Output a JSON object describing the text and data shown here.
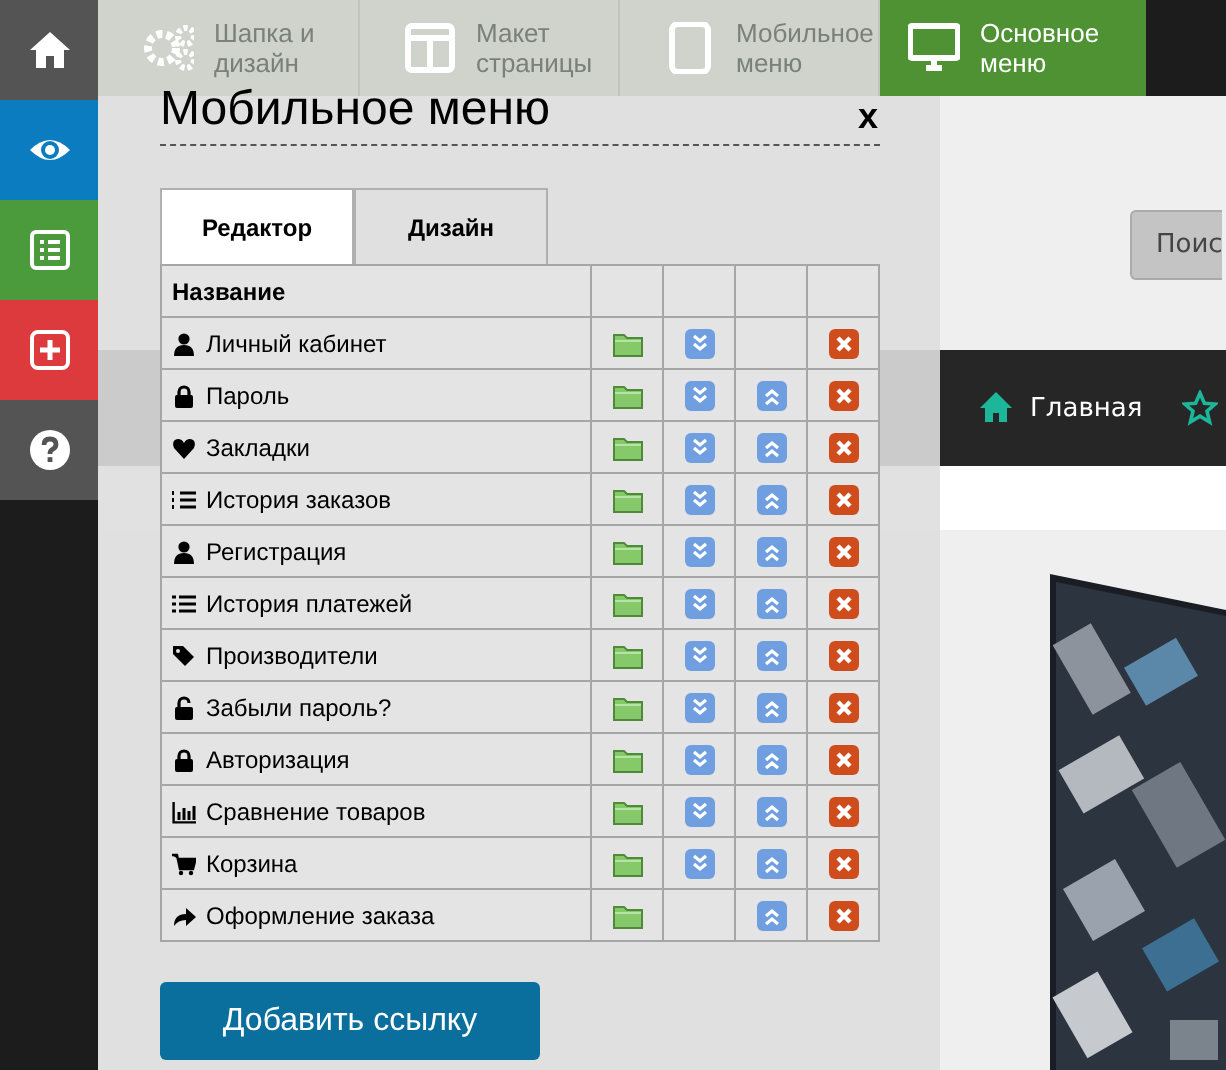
{
  "sidebar": {
    "items": [
      {
        "kind": "home",
        "color": "#545454"
      },
      {
        "kind": "eye",
        "color": "#0a7cbf"
      },
      {
        "kind": "list",
        "color": "#4b9a3c"
      },
      {
        "kind": "plus",
        "color": "#dc3a3d"
      },
      {
        "kind": "help",
        "color": "#545454"
      }
    ]
  },
  "top_tabs": [
    {
      "label": "Шапка и дизайн",
      "kind": "gears",
      "selected": false
    },
    {
      "label": "Макет страницы",
      "kind": "layout",
      "selected": false
    },
    {
      "label": "Мобильное меню",
      "kind": "tablet",
      "selected": false
    },
    {
      "label": "Основное меню",
      "kind": "monitor",
      "selected": true
    }
  ],
  "page": {
    "search_button": "Поис",
    "nav": [
      {
        "kind": "home",
        "label": "Главная"
      },
      {
        "kind": "star"
      }
    ],
    "kind": "picture"
  },
  "panel": {
    "title": "Мобильное меню",
    "close": "x",
    "tabs": [
      {
        "label": "Редактор",
        "selected": true
      },
      {
        "label": "Дизайн",
        "selected": false
      }
    ],
    "table": {
      "columns": [
        "Название"
      ],
      "rows": [
        {
          "kind": "user",
          "name": "Личный кабинет",
          "move_down": true,
          "move_up": false
        },
        {
          "kind": "lock",
          "name": "Пароль",
          "move_down": true,
          "move_up": true
        },
        {
          "kind": "heart",
          "name": "Закладки",
          "move_down": true,
          "move_up": true
        },
        {
          "kind": "olist",
          "name": "История заказов",
          "move_down": true,
          "move_up": true
        },
        {
          "kind": "user",
          "name": "Регистрация",
          "move_down": true,
          "move_up": true
        },
        {
          "kind": "list",
          "name": "История платежей",
          "move_down": true,
          "move_up": true
        },
        {
          "kind": "tags",
          "name": "Производители",
          "move_down": true,
          "move_up": true
        },
        {
          "kind": "unlock",
          "name": "Забыли пароль?",
          "move_down": true,
          "move_up": true
        },
        {
          "kind": "lock",
          "name": "Авторизация",
          "move_down": true,
          "move_up": true
        },
        {
          "kind": "chart",
          "name": "Сравнение товаров",
          "move_down": true,
          "move_up": true
        },
        {
          "kind": "cart",
          "name": "Корзина",
          "move_down": true,
          "move_up": true
        },
        {
          "kind": "share",
          "name": "Оформление заказа",
          "move_down": false,
          "move_up": true
        }
      ]
    },
    "add_button": "Добавить ссылку"
  }
}
